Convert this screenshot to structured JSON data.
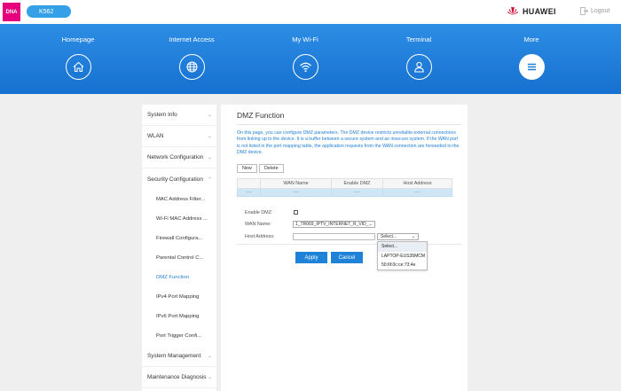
{
  "topbar": {
    "logo_text": "DNA",
    "device_name": "K562",
    "brand_name": "HUAWEI",
    "logout_label": "Logout"
  },
  "nav": {
    "items": [
      {
        "label": "Homepage",
        "icon": "home-icon"
      },
      {
        "label": "Internet Access",
        "icon": "globe-icon"
      },
      {
        "label": "My Wi-Fi",
        "icon": "wifi-icon"
      },
      {
        "label": "Terminal",
        "icon": "user-icon"
      },
      {
        "label": "More",
        "icon": "menu-icon"
      }
    ],
    "active": "More"
  },
  "sidebar": {
    "items": [
      {
        "label": "System Info",
        "chevron": "down"
      },
      {
        "label": "WLAN",
        "chevron": "down"
      },
      {
        "label": "Network Configuration",
        "chevron": "down"
      },
      {
        "label": "Security Configuration",
        "chevron": "up"
      },
      {
        "label": "MAC Address Filter..."
      },
      {
        "label": "Wi-Fi MAC Address ..."
      },
      {
        "label": "Firewall Configura..."
      },
      {
        "label": "Parental Control C..."
      },
      {
        "label": "DMZ Function"
      },
      {
        "label": "IPv4 Port Mapping"
      },
      {
        "label": "IPv6 Port Mapping"
      },
      {
        "label": "Port Trigger Confi..."
      },
      {
        "label": "System Management",
        "chevron": "down"
      },
      {
        "label": "Maintenance Diagnosis",
        "chevron": "down"
      }
    ],
    "active": "DMZ Function"
  },
  "panel": {
    "title": "DMZ Function",
    "description": "On this page, you can configure DMZ parameters. The DMZ device restricts unreliable external connections from linking up to the device. It is a buffer between a secure system and an insecure system. If the WAN port is not listed in the port mapping table, the application requests from the WAN connection are forwarded to the DMZ device.",
    "new_label": "New",
    "delete_label": "Delete",
    "table": {
      "headers": [
        "",
        "WAN Name",
        "Enable DMZ",
        "Host Address"
      ],
      "row": [
        "----",
        "----",
        "----",
        "----"
      ]
    },
    "form": {
      "enable_label": "Enable DMZ:",
      "enable_checked": false,
      "wan_label": "WAN Name:",
      "wan_value": "1_TR069_IPTV_INTERNET_R_VID_",
      "host_label": "Host Address:",
      "host_value": "",
      "host_select": "Select..."
    },
    "dropdown_options": [
      "Select...",
      "LAPTOP-EUS35MCM",
      "50:6f:0c:ce:73:4e"
    ],
    "apply_label": "Apply",
    "cancel_label": "Cancel"
  },
  "colors": {
    "accent": "#1d82d8",
    "nav_top": "#2d8ee6",
    "nav_bottom": "#1670cf",
    "brand_pink": "#e6007e",
    "row_highlight": "#cfe6f7"
  }
}
